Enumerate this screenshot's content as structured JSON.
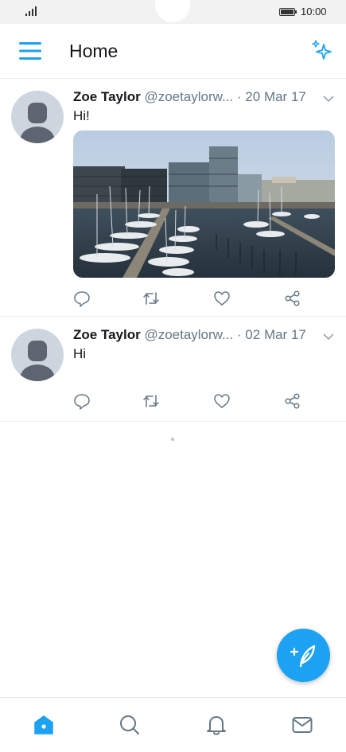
{
  "status_bar": {
    "time": "10:00",
    "signal_icon": "signal-icon",
    "battery_icon": "battery-icon"
  },
  "header": {
    "title": "Home",
    "menu_icon": "hamburger-menu-icon",
    "sparkle_icon": "sparkle-icon"
  },
  "tweets": [
    {
      "name": "Zoe Taylor",
      "handle": "@zoetaylorw...",
      "date": "· 20 Mar 17",
      "text": "Hi!",
      "has_media": true,
      "media_description": "harbor-photo"
    },
    {
      "name": "Zoe Taylor",
      "handle": "@zoetaylorw...",
      "date": "· 02 Mar 17",
      "text": "Hi",
      "has_media": false
    }
  ],
  "actions": [
    "reply-icon",
    "retweet-icon",
    "like-icon",
    "share-icon"
  ],
  "fab": {
    "icon": "compose-tweet-icon"
  },
  "bottom_nav": [
    "home-icon",
    "search-icon",
    "notifications-icon",
    "messages-icon"
  ],
  "colors": {
    "accent": "#1da1f2",
    "text": "#14171a",
    "secondary": "#657786",
    "divider": "#e6ecf0"
  }
}
